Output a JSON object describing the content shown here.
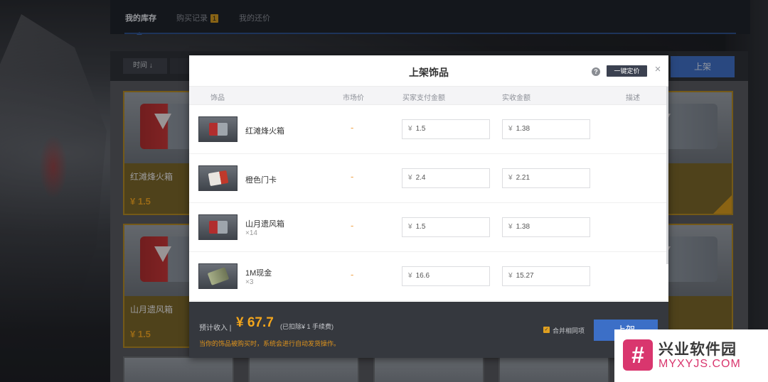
{
  "nav": {
    "tabs": [
      {
        "label": "我的库存",
        "active": true
      },
      {
        "label": "购买记录",
        "badge": "1"
      },
      {
        "label": "我的还价"
      }
    ]
  },
  "filter": {
    "sort_time_label": "时间 ↓",
    "list_button_label": "上架"
  },
  "cards": [
    {
      "name": "红滩烽火箱",
      "price": "¥ 1.5"
    },
    {
      "name": "山月遗风箱",
      "price": "¥ 1.5"
    }
  ],
  "modal": {
    "title": "上架饰品",
    "help_icon": "?",
    "oneclick_label": "一键定价",
    "close_icon": "×",
    "columns": {
      "item": "饰品",
      "market": "市场价",
      "buyer_pay": "买家支付金额",
      "receive": "实收金额",
      "desc": "描述"
    },
    "rows": [
      {
        "name": "红滩烽火箱",
        "qty": "",
        "market": "-",
        "buyer_pay": "1.5",
        "receive": "1.38",
        "thumb": "case"
      },
      {
        "name": "橙色门卡",
        "qty": "",
        "market": "-",
        "buyer_pay": "2.4",
        "receive": "2.21",
        "thumb": "card"
      },
      {
        "name": "山月遗风箱",
        "qty": "×14",
        "market": "-",
        "buyer_pay": "1.5",
        "receive": "1.38",
        "thumb": "case"
      },
      {
        "name": "1M现金",
        "qty": "×3",
        "market": "-",
        "buyer_pay": "16.6",
        "receive": "15.27",
        "thumb": "money"
      }
    ],
    "currency": "¥",
    "footer": {
      "income_label": "预计收入 |",
      "income_value": "¥ 67.7",
      "income_fee": "(已扣除¥ 1 手续费)",
      "auto_note": "当你的饰品被购买时，系统会进行自动发货操作。",
      "merge_label": "合并相同项",
      "merge_checked": true,
      "list_button_label": "上架"
    }
  },
  "watermark": {
    "logo_glyph": "#",
    "title": "兴业软件园",
    "url": "MYXYJS.COM"
  },
  "colors": {
    "accent_blue": "#3c6fc7",
    "price_orange": "#f2a51c",
    "watermark_pink": "#d9366e"
  }
}
